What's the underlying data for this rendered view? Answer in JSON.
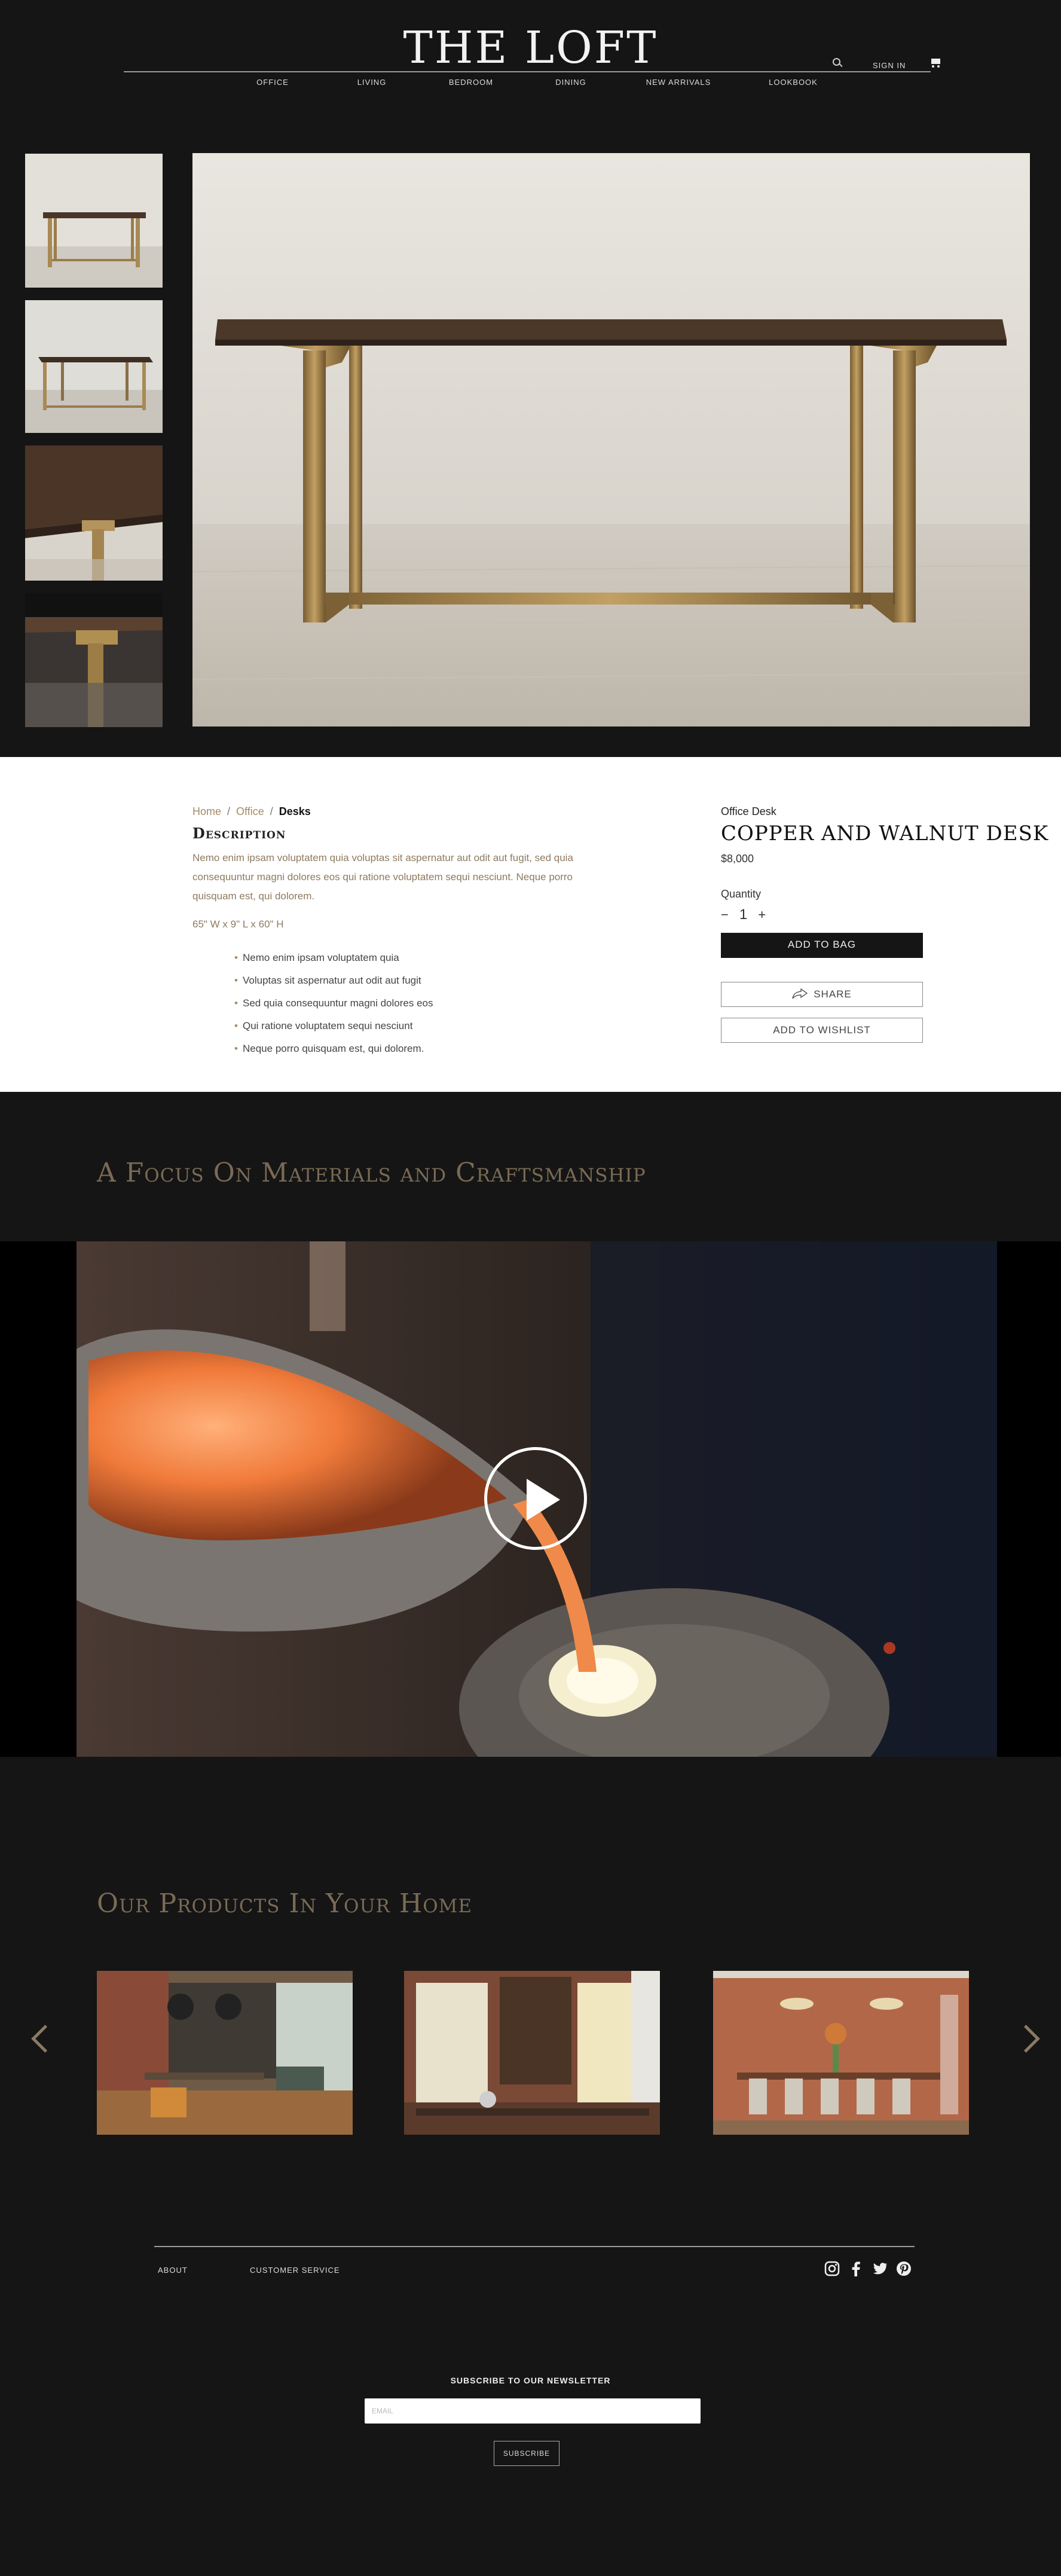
{
  "header": {
    "logo": "THE LOFT",
    "search_icon": "search-icon",
    "sign_in": "SIGN IN",
    "cart_icon": "cart-icon",
    "nav": [
      "OFFICE",
      "LIVING",
      "BEDROOM",
      "DINING",
      "NEW ARRIVALS",
      "LOOKBOOK"
    ]
  },
  "gallery": {
    "thumbnails": [
      "desk-front-thumbnail",
      "desk-angle-thumbnail",
      "desk-top-detail-thumbnail",
      "desk-leg-detail-thumbnail"
    ],
    "main_image": "copper-and-walnut-desk-photo"
  },
  "product": {
    "breadcrumb": [
      "Home",
      "Office",
      "Desks"
    ],
    "description_heading": "Description",
    "description": "Nemo enim ipsam voluptatem quia voluptas sit aspernatur aut odit aut fugit, sed quia consequuntur magni dolores eos qui ratione voluptatem sequi nesciunt. Neque porro quisquam est, qui dolorem.",
    "dimensions": "65\" W x 9\" L x 60\" H",
    "features": [
      "Nemo enim ipsam voluptatem quia",
      "Voluptas sit aspernatur aut odit aut fugit",
      "Sed quia consequuntur magni dolores eos",
      "Qui ratione voluptatem sequi nesciunt",
      "Neque porro quisquam est, qui dolorem."
    ],
    "category": "Office Desk",
    "title": "COPPER AND WALNUT DESK",
    "price": "$8,000",
    "quantity_label": "Quantity",
    "quantity_minus": "−",
    "quantity": "1",
    "quantity_plus": "+",
    "add_to_bag": "ADD TO BAG",
    "share": "SHARE",
    "add_to_wishlist": "ADD TO WISHLIST"
  },
  "craft": {
    "title": "A Focus On Materials and Craftsmanship",
    "video": "molten-copper-pour-video",
    "play_icon": "play-icon"
  },
  "home": {
    "title": "Our Products In Your Home",
    "prev_icon": "chevron-left-icon",
    "next_icon": "chevron-right-icon",
    "images": [
      "loft-dining-room-photo",
      "loft-study-photo",
      "brick-dining-room-photo"
    ]
  },
  "footer": {
    "about": "ABOUT",
    "customer_service": "CUSTOMER SERVICE",
    "socials": [
      "instagram-icon",
      "facebook-icon",
      "twitter-icon",
      "pinterest-icon"
    ],
    "newsletter_title": "SUBSCRIBE TO OUR NEWSLETTER",
    "email_placeholder": "EMAIL",
    "subscribe": "SUBSCRIBE"
  },
  "colors": {
    "background": "#151515",
    "accent": "#a48a6a",
    "heading_muted": "#7a6a55",
    "panel": "#ffffff"
  }
}
